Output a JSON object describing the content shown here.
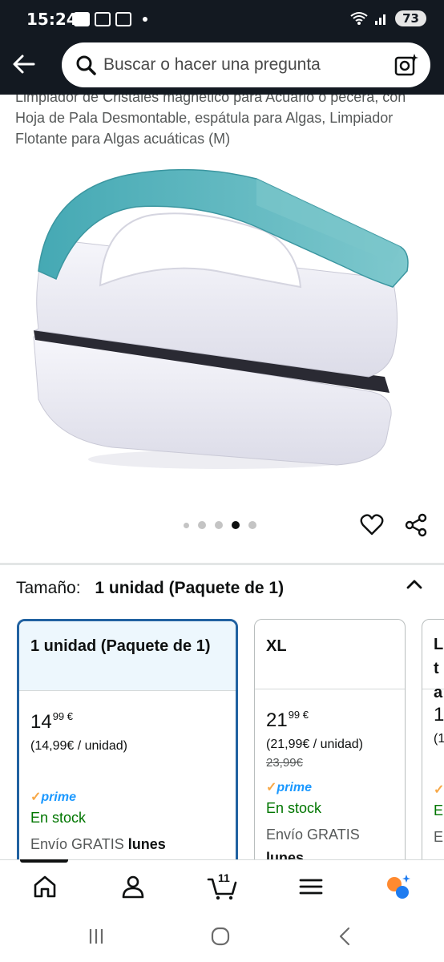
{
  "status_bar": {
    "time": "15:24",
    "battery": "73"
  },
  "header": {
    "search_placeholder": "Buscar o hacer una pregunta"
  },
  "product": {
    "title": "Limpiador de Cristales magnético para Acuario o pecera, con Hoja de Pala Desmontable, espátula para Algas, Limpiador Flotante para Algas acuáticas (M)",
    "image_count": 5,
    "active_image_index": 3
  },
  "size_selector": {
    "label": "Tamaño:",
    "selected_value": "1 unidad (Paquete de 1)",
    "options": [
      {
        "name": "1 unidad (Paquete de 1)",
        "price_whole": "14",
        "price_fraction": "99 €",
        "unit_price": "(14,99€ / unidad)",
        "old_price": "",
        "prime": "prime",
        "stock": "En stock",
        "delivery_text": "Envío GRATIS",
        "delivery_day": "lunes"
      },
      {
        "name": "XL",
        "price_whole": "21",
        "price_fraction": "99 €",
        "unit_price": "(21,99€ / unidad)",
        "old_price": "23,99€",
        "prime": "prime",
        "stock": "En stock",
        "delivery_text": "Envío GRATIS",
        "delivery_day": "lunes"
      },
      {
        "name": "L ta",
        "price_whole": "1",
        "price_fraction": "",
        "unit_price": "(1",
        "old_price": "",
        "prime": "",
        "stock": "E",
        "delivery_text": "E",
        "delivery_day": ""
      }
    ]
  },
  "bottom_nav": {
    "cart_count": "11",
    "items": [
      "home-icon",
      "account-icon",
      "cart-icon",
      "menu-icon",
      "rufus-icon"
    ]
  },
  "colors": {
    "header_bg": "#131921",
    "selected_border": "#2162a1",
    "stock_green": "#007600",
    "prime_blue": "#1a98ff"
  }
}
